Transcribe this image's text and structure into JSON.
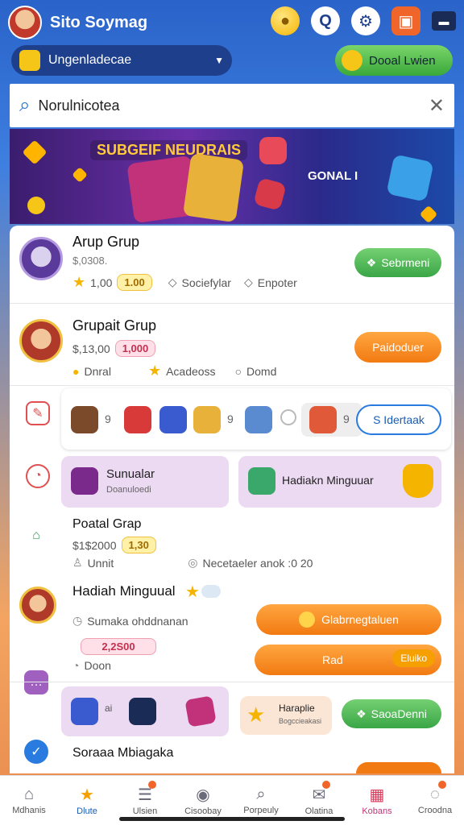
{
  "header": {
    "title": "Sito Soymag",
    "icons": [
      "coin-icon",
      "q-icon",
      "gear-icon",
      "gift-icon",
      "flag-icon"
    ]
  },
  "subbar": {
    "label": "Ungenladecae",
    "donate_label": "Dooal Lwien"
  },
  "search": {
    "value": "Norulnicotea"
  },
  "banner": {
    "title": "SUBGEIF NEUDRAIS",
    "subtitle": "GONAL I"
  },
  "groups": [
    {
      "name": "Arup Grup",
      "price": "$,0308.",
      "pill": "1,00",
      "pill_b": "1.00",
      "meta_a": "Sociefylar",
      "meta_b": "Enpoter",
      "button": "Sebrmeni"
    },
    {
      "name": "Grupait Grup",
      "price": "$,13,00",
      "pill": "1,000",
      "meta_a": "Dnral",
      "meta_b": "Acadeoss",
      "meta_c": "Domd",
      "button": "Paidoduer"
    }
  ],
  "apps_row": {
    "button": "S Idertaak",
    "sep_a": "9",
    "sep_b": "9",
    "sep_c": "9"
  },
  "lilac_row": {
    "left_title": "Sunualar",
    "left_sub": "Doanuloedi",
    "right_title": "Hadiakn Minguuar"
  },
  "poatal": {
    "name": "Poatal Grap",
    "price": "$1$2000",
    "pill": "1,30",
    "meta_a": "Unnit",
    "meta_b": "Necetaeler anok :0 20"
  },
  "hadiah": {
    "title": "Hadiah Minguual",
    "meta_a": "Sumaka ohddnanan",
    "pink_pill": "2,2S00",
    "meta_b": "Doon",
    "btn_a": "Glabrnegtaluen",
    "btn_b": "Rad",
    "btn_b_right": "Eluiko"
  },
  "bottom_row": {
    "card_title": "Haraplie",
    "card_sub": "Bogccieakasi",
    "button": "SaoaDenni",
    "tile_label": "ai"
  },
  "footer_item": {
    "title": "Soraaa Mbiagaka"
  },
  "tabs": [
    {
      "label": "Mdhanis",
      "icon": "home-icon"
    },
    {
      "label": "Dlute",
      "icon": "star-icon",
      "active": true
    },
    {
      "label": "Ulsien",
      "icon": "list-icon"
    },
    {
      "label": "Cisoobay",
      "icon": "bear-icon"
    },
    {
      "label": "Porpeuly",
      "icon": "search-icon"
    },
    {
      "label": "Olatina",
      "icon": "mail-icon"
    },
    {
      "label": "Kobans",
      "icon": "grid-icon"
    },
    {
      "label": "Croodna",
      "icon": "chat-icon"
    }
  ]
}
